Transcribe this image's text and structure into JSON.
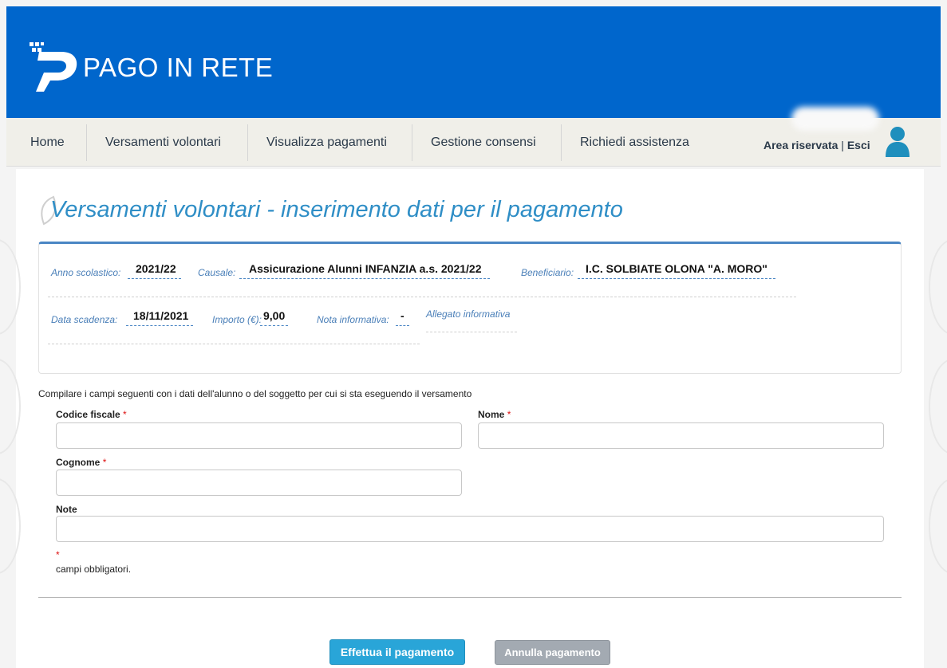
{
  "header": {
    "brand": "PAGO IN RETE",
    "logo_icon": "pago-in-rete-logo-icon",
    "color": "#0066cc"
  },
  "nav": {
    "items": [
      {
        "label": "Home"
      },
      {
        "label": "Versamenti volontari"
      },
      {
        "label": "Visualizza pagamenti"
      },
      {
        "label": "Gestione consensi"
      },
      {
        "label": "Richiedi assistenza"
      }
    ],
    "area_riservata": "Area riservata",
    "separator": "|",
    "esci": "Esci",
    "user_icon": "user-icon"
  },
  "page": {
    "title": "Versamenti volontari - inserimento dati per il pagamento"
  },
  "info": {
    "anno_label": "Anno scolastico:",
    "anno_value": "2021/22",
    "causale_label": "Causale:",
    "causale_value": "Assicurazione Alunni INFANZIA a.s. 2021/22",
    "beneficiario_label": "Beneficiario:",
    "beneficiario_value": "I.C. SOLBIATE OLONA \"A. MORO\"",
    "scadenza_label": "Data scadenza:",
    "scadenza_value": "18/11/2021",
    "importo_label": "Importo (€):",
    "importo_value": "9,00",
    "nota_label": "Nota informativa:",
    "nota_value": "-",
    "allegato_label": "Allegato informativa"
  },
  "form": {
    "instructions": "Compilare i campi seguenti con i dati dell'alunno o del soggetto per cui si sta eseguendo il versamento",
    "codice_fiscale_label": "Codice fiscale",
    "nome_label": "Nome",
    "cognome_label": "Cognome",
    "note_label": "Note",
    "required_mark": "*",
    "required_note": "campi obbligatori.",
    "codice_fiscale_value": "",
    "nome_value": "",
    "cognome_value": "",
    "note_value": ""
  },
  "buttons": {
    "pay": "Effettua il pagamento",
    "cancel": "Annulla pagamento",
    "pay_color": "#29a5d8",
    "cancel_color": "#a3aab2"
  }
}
